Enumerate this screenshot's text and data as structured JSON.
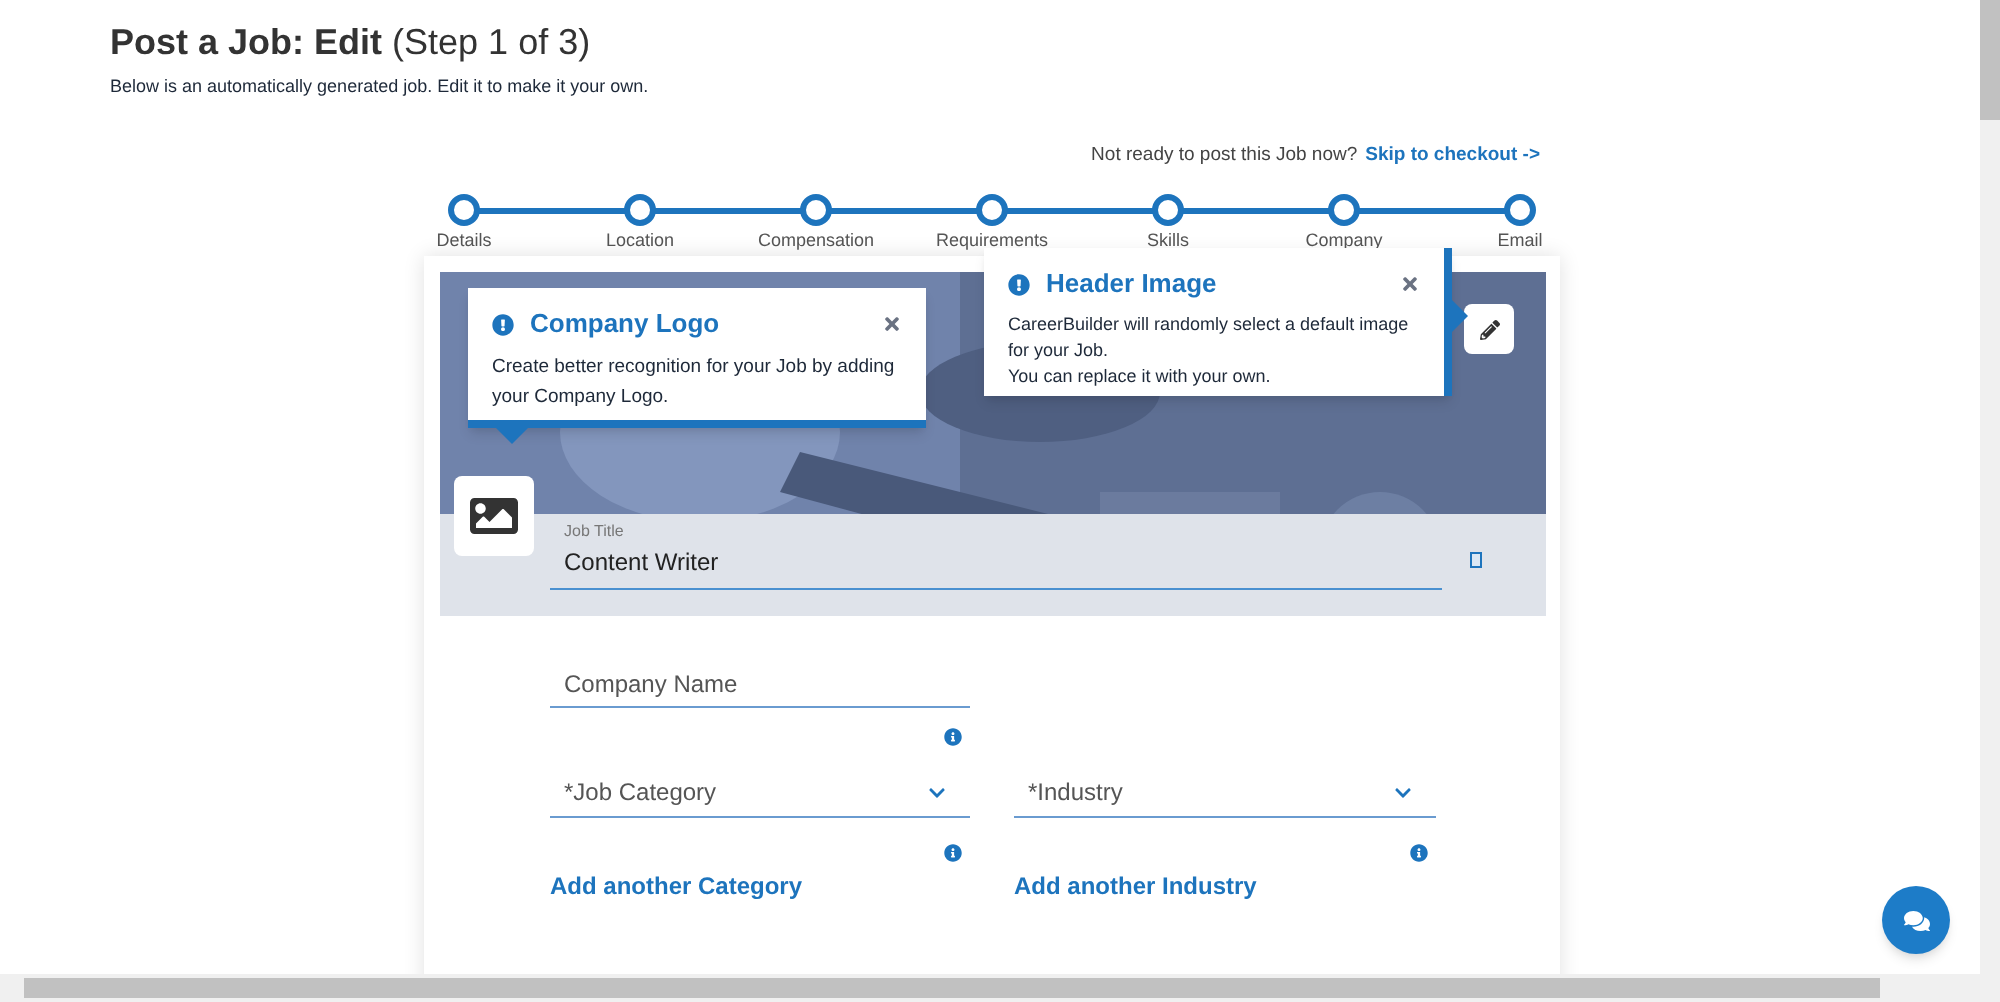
{
  "page": {
    "title": "Post a Job: Edit",
    "step_note": "(Step 1 of 3)",
    "subtitle": "Below is an automatically generated job. Edit it to make it your own.",
    "skip_prompt": "Not ready to post this Job now?",
    "skip_link": "Skip to checkout ->"
  },
  "steps": [
    {
      "label": "Details"
    },
    {
      "label": "Location"
    },
    {
      "label": "Compensation"
    },
    {
      "label": "Requirements"
    },
    {
      "label": "Skills"
    },
    {
      "label": "Company"
    },
    {
      "label": "Email"
    }
  ],
  "tooltips": [
    {
      "title": "Company Logo",
      "lines": [
        "Create better recognition for your Job by adding your Company Logo."
      ]
    },
    {
      "title": "Header Image",
      "lines": [
        "CareerBuilder will randomly select a default image for your Job.",
        "You can replace it with your own."
      ]
    }
  ],
  "job_title": {
    "label": "Job Title",
    "value": "Content Writer"
  },
  "company_name": {
    "placeholder": "Company Name"
  },
  "selects": [
    {
      "placeholder": "*Job Category",
      "add_link": "Add another Category"
    },
    {
      "placeholder": "*Industry",
      "add_link": "Add another Industry"
    }
  ]
}
